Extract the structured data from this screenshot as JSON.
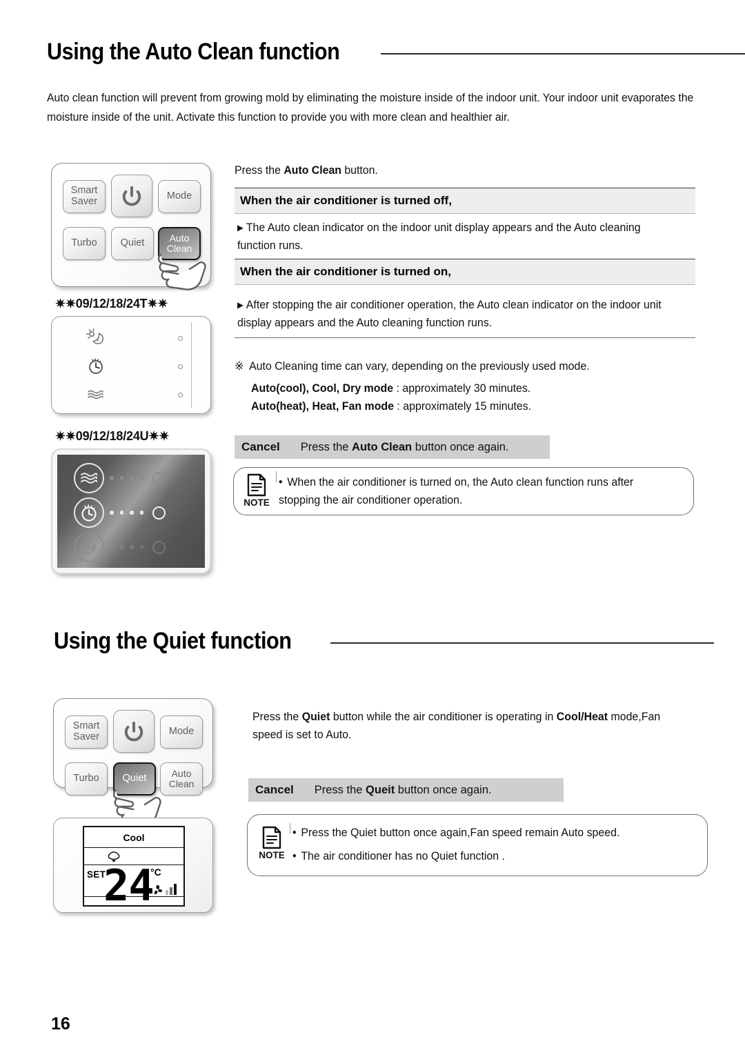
{
  "page": {
    "number": "16"
  },
  "sections": [
    {
      "id": "auto-clean",
      "title": "Using the Auto Clean function",
      "intro": "Auto clean function will prevent from growing mold by eliminating the moisture inside of the indoor unit. Your indoor unit evaporates the moisture inside of the unit. Activate this function to provide you with more clean and healthier air.",
      "remote": {
        "buttons": [
          {
            "name": "smart-saver",
            "label": "Smart\nSaver",
            "state": "normal"
          },
          {
            "name": "power",
            "label": "",
            "state": "normal"
          },
          {
            "name": "mode",
            "label": "Mode",
            "state": "normal"
          },
          {
            "name": "turbo",
            "label": "Turbo",
            "state": "normal"
          },
          {
            "name": "quiet",
            "label": "Quiet",
            "state": "normal"
          },
          {
            "name": "auto-clean",
            "label": "Auto\nClean",
            "state": "pressed"
          }
        ],
        "smart_saver_line1": "Smart",
        "smart_saver_line2": "Saver",
        "mode": "Mode",
        "turbo": "Turbo",
        "quiet": "Quiet",
        "auto_clean_line1": "Auto",
        "auto_clean_line2": "Clean"
      },
      "display_t_label": "✷✷09/12/18/24T✷✷",
      "display_u_label": "✷✷09/12/18/24U✷✷",
      "lead": {
        "pre": "Press the ",
        "bold": "Auto Clean",
        "post": " button."
      },
      "state_off": {
        "header": "When the air conditioner is turned off,",
        "body": "The Auto clean indicator on the indoor unit display appears and the Auto cleaning function runs."
      },
      "state_on": {
        "header": "When the air conditioner is turned on,",
        "body": "After stopping the air conditioner operation, the Auto clean indicator on the indoor unit display appears and the Auto cleaning function runs."
      },
      "note_time": {
        "mark": "※",
        "line": "Auto Cleaning time can vary, depending on the previously used mode.",
        "rows": [
          {
            "bold": "Auto(cool), Cool, Dry mode",
            "rest": " : approximately 30 minutes."
          },
          {
            "bold": "Auto(heat), Heat, Fan mode",
            "rest": " : approximately 15 minutes."
          }
        ]
      },
      "cancel": {
        "word": "Cancel",
        "pre": "Press the ",
        "bold": "Auto Clean",
        "post": " button once again."
      },
      "note": {
        "label": "NOTE",
        "items": [
          "When the air conditioner is turned on, the Auto clean function runs after stopping the air conditioner operation."
        ]
      }
    },
    {
      "id": "quiet",
      "title": "Using the Quiet function",
      "remote": {
        "smart_saver_line1": "Smart",
        "smart_saver_line2": "Saver",
        "mode": "Mode",
        "turbo": "Turbo",
        "quiet": "Quiet",
        "auto_clean_line1": "Auto",
        "auto_clean_line2": "Clean"
      },
      "lead": {
        "p1_a": "Press the ",
        "p1_b": "Quiet",
        "p1_c": " button while the air conditioner is operating in ",
        "p1_d": "Cool/Heat",
        "p1_e": " mode,Fan speed is set to Auto."
      },
      "cancel": {
        "word": "Cancel",
        "pre": "Press the ",
        "bold": "Queit",
        "post": " button once again."
      },
      "note": {
        "label": "NOTE",
        "items": [
          "Press the Quiet button once again,Fan speed remain Auto speed.",
          "The air conditioner has no Quiet function ."
        ]
      },
      "lcd": {
        "mode": "Cool",
        "set_label": "SET",
        "temperature": "24",
        "unit": "°C"
      }
    }
  ],
  "colors": {
    "gray_header_bg": "#ededed",
    "cancel_bar_bg": "#cfcfcf",
    "rule_dark": "#2a2a2a",
    "text": "#111111"
  }
}
